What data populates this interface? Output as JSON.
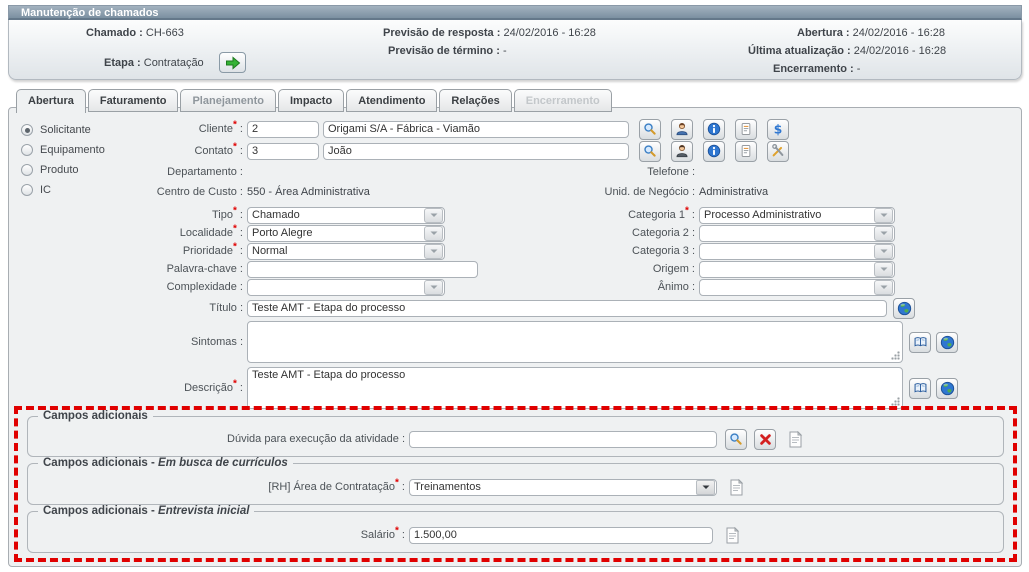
{
  "window_title": "Manutenção de chamados",
  "ui": {
    "req": "*",
    "colon": " :"
  },
  "colors": {
    "titlebar_start": "#a3b2bf",
    "titlebar_end": "#7b90a1",
    "panel_bg": "#eff1f2",
    "required": "#e00000",
    "highlight_border": "#e00000"
  },
  "icons": {
    "advance": "green-arrow-right",
    "search": "magnifier",
    "user": "person",
    "info": "info-circle",
    "notes": "document-lines",
    "money": "dollar-sign",
    "tools": "wrench-and-screwdriver",
    "globe": "globe",
    "book": "open-book",
    "clear": "red-x",
    "doc": "document",
    "dropdown": "down-arrow"
  },
  "header": {
    "chamado": {
      "label": "Chamado :",
      "value": "CH-663"
    },
    "resposta": {
      "label": "Previsão de resposta :",
      "value": "24/02/2016 - 16:28"
    },
    "termino": {
      "label": "Previsão de término :",
      "value": "-"
    },
    "abertura": {
      "label": "Abertura :",
      "value": "24/02/2016 - 16:28"
    },
    "ultima": {
      "label": "Última atualização :",
      "value": "24/02/2016 - 16:28"
    },
    "encerra": {
      "label": "Encerramento :",
      "value": "-"
    },
    "etapa": {
      "label": "Etapa :",
      "value": "Contratação"
    }
  },
  "tabs": [
    {
      "label": "Abertura"
    },
    {
      "label": "Faturamento"
    },
    {
      "label": "Planejamento"
    },
    {
      "label": "Impacto"
    },
    {
      "label": "Atendimento"
    },
    {
      "label": "Relações"
    },
    {
      "label": "Encerramento"
    }
  ],
  "radios": [
    {
      "label": "Solicitante",
      "selected": true
    },
    {
      "label": "Equipamento",
      "selected": false
    },
    {
      "label": "Produto",
      "selected": false
    },
    {
      "label": "IC",
      "selected": false
    }
  ],
  "form": {
    "cliente_label": "Cliente",
    "cliente_code": "2",
    "cliente_name": "Origami S/A - Fábrica - Viamão",
    "contato_label": "Contato",
    "contato_code": "3",
    "contato_name": "João",
    "departamento_label": "Departamento :",
    "telefone_label": "Telefone :",
    "centro_custo_label": "Centro de Custo :",
    "centro_custo_value": "550 - Área Administrativa",
    "unid_negocio_label": "Unid. de Negócio :",
    "unid_negocio_value": "Administrativa",
    "tipo_label": "Tipo",
    "tipo_value": "Chamado",
    "localidade_label": "Localidade",
    "localidade_value": "Porto Alegre",
    "prioridade_label": "Prioridade",
    "prioridade_value": "Normal",
    "palavra_chave_label": "Palavra-chave :",
    "palavra_chave_value": "",
    "complexidade_label": "Complexidade :",
    "complexidade_value": "",
    "categoria1_label": "Categoria 1",
    "categoria1_value": "Processo Administrativo",
    "categoria2_label": "Categoria 2 :",
    "categoria2_value": "",
    "categoria3_label": "Categoria 3 :",
    "categoria3_value": "",
    "origem_label": "Origem :",
    "origem_value": "",
    "animo_label": "Ânimo :",
    "animo_value": "",
    "titulo_label": "Título :",
    "titulo_value": "Teste AMT - Etapa do processo",
    "sintomas_label": "Sintomas :",
    "sintomas_value": "",
    "descricao_label": "Descrição",
    "descricao_value": "Teste AMT - Etapa do processo"
  },
  "adicionais": {
    "s1": {
      "legend": "Campos adicionais",
      "duvida_label": "Dúvida para execução da atividade :",
      "duvida_value": ""
    },
    "s2": {
      "legend_prefix": "Campos adicionais - ",
      "legend_suffix": "Em busca de currículos",
      "rh_label": "[RH] Área de Contratação",
      "rh_value": "Treinamentos"
    },
    "s3": {
      "legend_prefix": "Campos adicionais - ",
      "legend_suffix": "Entrevista inicial",
      "salario_label": "Salário",
      "salario_value": "1.500,00"
    }
  }
}
